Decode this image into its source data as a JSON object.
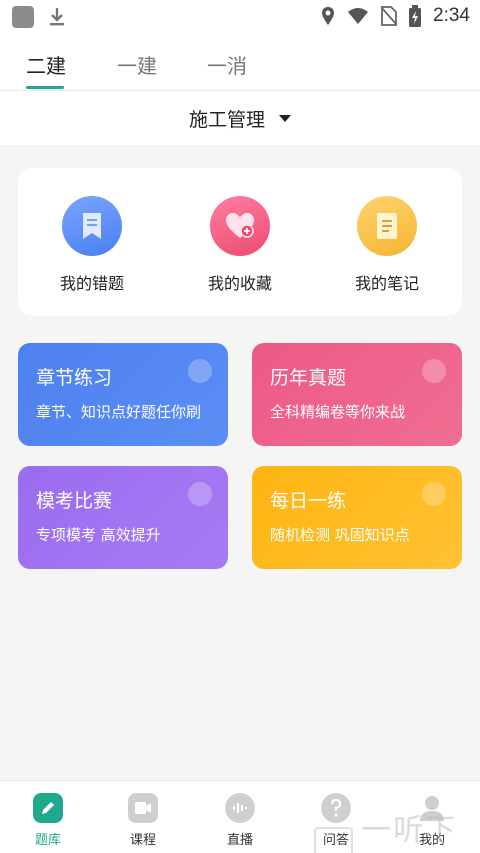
{
  "status": {
    "time": "2:34"
  },
  "tabs": [
    {
      "label": "二建",
      "active": true
    },
    {
      "label": "一建",
      "active": false
    },
    {
      "label": "一消",
      "active": false
    }
  ],
  "subject": {
    "label": "施工管理"
  },
  "quick": [
    {
      "label": "我的错题",
      "icon": "wrong-questions-icon"
    },
    {
      "label": "我的收藏",
      "icon": "favorites-heart-icon"
    },
    {
      "label": "我的笔记",
      "icon": "notes-icon"
    }
  ],
  "tiles": [
    {
      "title": "章节练习",
      "sub": "章节、知识点好题任你刷",
      "color": "#4f80f0"
    },
    {
      "title": "历年真题",
      "sub": "全科精编卷等你来战",
      "color": "#ec5a86"
    },
    {
      "title": "模考比赛",
      "sub": "专项模考 高效提升",
      "color": "#9a6cf0"
    },
    {
      "title": "每日一练",
      "sub": "随机检测 巩固知识点",
      "color": "#ffb411"
    }
  ],
  "nav": [
    {
      "label": "题库",
      "active": true
    },
    {
      "label": "课程",
      "active": false
    },
    {
      "label": "直播",
      "active": false
    },
    {
      "label": "问答",
      "active": false
    },
    {
      "label": "我的",
      "active": false
    }
  ],
  "watermark": {
    "text": "一听下载"
  },
  "colors": {
    "accent": "#1ea88d"
  }
}
